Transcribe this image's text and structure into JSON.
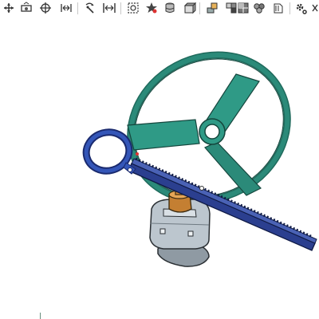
{
  "app": {
    "mode": "3D part viewer"
  },
  "toolbar": {
    "buttons": [
      {
        "name": "view-orientation-icon"
      },
      {
        "name": "section-view-icon"
      },
      {
        "name": "move-icon"
      },
      {
        "name": "flip-icon"
      },
      {
        "name": "rotate-icon"
      },
      {
        "name": "fit-view-icon"
      },
      {
        "name": "zoom-area-icon"
      },
      {
        "name": "appearance-icon"
      },
      {
        "name": "database-icon"
      },
      {
        "name": "display-style-icon"
      },
      {
        "name": "part-icon"
      },
      {
        "name": "assembly-icon"
      },
      {
        "name": "grid-icon"
      },
      {
        "name": "components-icon"
      },
      {
        "name": "document-icon"
      },
      {
        "name": "settings-icon"
      },
      {
        "name": "more-icon"
      }
    ]
  },
  "colors": {
    "wheel": "#2b8a79",
    "wheel_dark": "#1f6a5c",
    "rack": "#2b3f8f",
    "rack_dark": "#1a2a6e",
    "ring": "#3456b8",
    "housing": "#b9c4cc",
    "brass": "#d08a3a"
  }
}
